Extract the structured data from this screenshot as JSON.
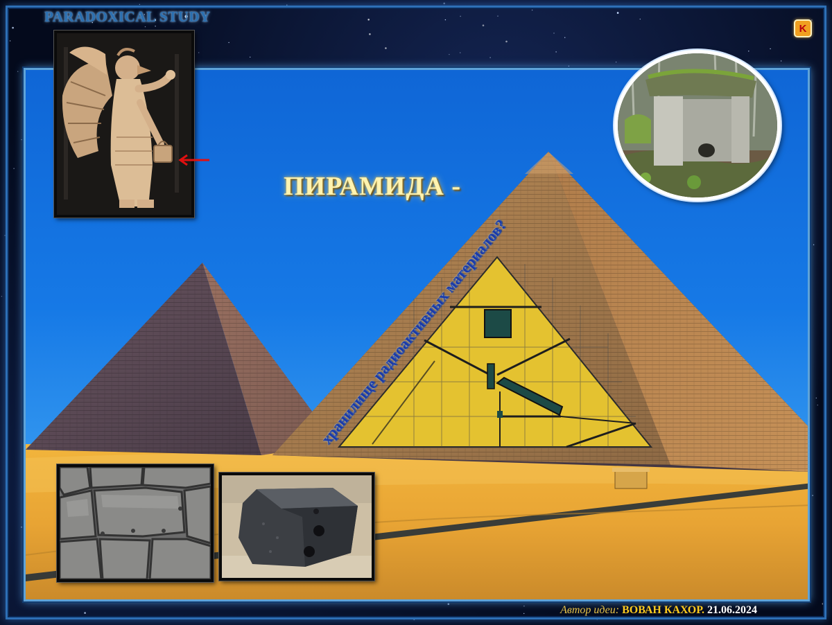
{
  "series_title": "PARADOXICAL STUDY",
  "headline": "ПИРАМИДА -",
  "diagonal_caption": "хранилище радиоактивных материалов?",
  "credit": {
    "label": "Автор идеи:",
    "author": "ВОВАН КАХОР.",
    "date": "21.06.2024"
  },
  "brand_badge": "K",
  "icons": {
    "brand": "k-logo-icon",
    "arrow": "red-arrow-icon"
  },
  "colors": {
    "sky": "#1679e6",
    "frame": "#2d6fb6",
    "headline": "#fff3b0",
    "caption": "#1b3aa8",
    "credit_name": "#ffcb1f",
    "credit_label": "#e8c44a",
    "arrow": "#e01010",
    "cutaway": "#e4c230"
  }
}
